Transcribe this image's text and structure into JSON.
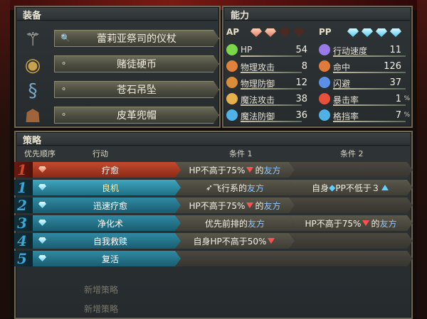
{
  "equipment": {
    "title": "装备",
    "items": [
      {
        "name": "蕾莉亚祭司的仪杖",
        "icon": "staff-icon"
      },
      {
        "name": "赌徒硬币",
        "icon": "coin-icon"
      },
      {
        "name": "苍石吊坠",
        "icon": "pendant-icon"
      },
      {
        "name": "皮革兜帽",
        "icon": "hood-icon"
      }
    ]
  },
  "abilities": {
    "title": "能力",
    "ap_label": "AP",
    "pp_label": "PP",
    "ap_filled": 2,
    "ap_total": 4,
    "pp_filled": 4,
    "pp_total": 4,
    "stats_left": [
      {
        "name": "HP",
        "value": "54",
        "icon": "heart-icon",
        "color": "#7bd64a"
      },
      {
        "name": "物理攻击",
        "value": "8",
        "icon": "sword-icon",
        "color": "#e0823a"
      },
      {
        "name": "物理防御",
        "value": "12",
        "icon": "shield-icon",
        "color": "#d98c3a"
      },
      {
        "name": "魔法攻击",
        "value": "38",
        "icon": "wand-icon",
        "color": "#e6b04a"
      },
      {
        "name": "魔法防御",
        "value": "36",
        "icon": "magic-shield-icon",
        "color": "#4fb2e8"
      }
    ],
    "stats_right": [
      {
        "name": "行动速度",
        "value": "11",
        "unit": "",
        "icon": "speed-icon",
        "color": "#9a7ae8"
      },
      {
        "name": "命中",
        "value": "126",
        "unit": "",
        "icon": "target-icon",
        "color": "#e07a3a"
      },
      {
        "name": "闪避",
        "value": "37",
        "unit": "",
        "icon": "evade-icon",
        "color": "#5a8fe8"
      },
      {
        "name": "暴击率",
        "value": "1",
        "unit": "%",
        "icon": "critical-icon",
        "color": "#e8503a"
      },
      {
        "name": "格挡率",
        "value": "7",
        "unit": "%",
        "icon": "block-icon",
        "color": "#4fb2e8"
      }
    ]
  },
  "strategy": {
    "title": "策略",
    "headers": {
      "priority": "优先顺序",
      "action": "行动",
      "cond1": "条件 1",
      "cond2": "条件 2"
    },
    "rows": [
      {
        "num": "1",
        "numColor": "#d04a2a",
        "action": "疗愈",
        "style": "red",
        "c1": {
          "a": "HP不高于75%",
          "b": "的",
          "c": "友方",
          "tri": "down"
        },
        "c2": null
      },
      {
        "num": "1",
        "numColor": "#3aa7d8",
        "action": "良机",
        "style": "blue-sel",
        "c1": {
          "a": "飞行系的",
          "b": "",
          "c": "友方",
          "tri": "",
          "pre": "wing"
        },
        "c2": {
          "a": "自身",
          "b": "PP不低于３",
          "c": "",
          "tri": "up"
        }
      },
      {
        "num": "2",
        "numColor": "#3aa7d8",
        "action": "迅速疗愈",
        "style": "blue",
        "c1": {
          "a": "HP不高于75%",
          "b": "的",
          "c": "友方",
          "tri": "down"
        },
        "c2": null
      },
      {
        "num": "3",
        "numColor": "#3aa7d8",
        "action": "净化术",
        "style": "blue",
        "c1": {
          "a": "优先前排的",
          "b": "",
          "c": "友方",
          "tri": ""
        },
        "c2": {
          "a": "HP不高于75%",
          "b": "的",
          "c": "友方",
          "tri": "down"
        }
      },
      {
        "num": "4",
        "numColor": "#3aa7d8",
        "action": "自我救赎",
        "style": "blue",
        "c1": {
          "a": "自身HP不高于50%",
          "b": "",
          "c": "",
          "tri": "down"
        },
        "c2": null
      },
      {
        "num": "5",
        "numColor": "#3aa7d8",
        "action": "复活",
        "style": "blue",
        "c1": null,
        "c2": null
      }
    ],
    "add_label": "新增策略"
  }
}
